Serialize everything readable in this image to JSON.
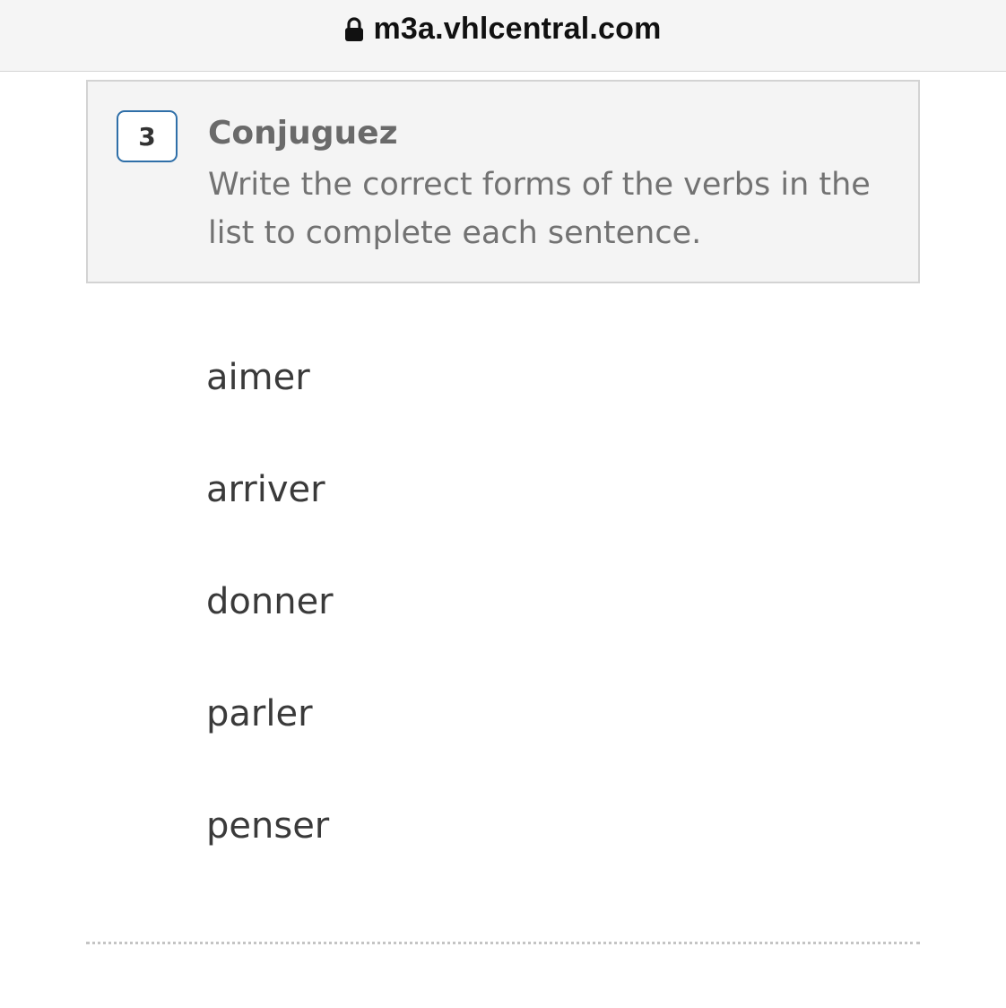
{
  "browser": {
    "url": "m3a.vhlcentral.com",
    "lock_icon": "lock-icon"
  },
  "activity": {
    "number": "3",
    "title": "Conjuguez",
    "instructions": "Write the correct forms of the verbs in the list to complete each sentence.",
    "badge_color": "#2f6fa8"
  },
  "verbs": [
    "aimer",
    "arriver",
    "donner",
    "parler",
    "penser"
  ]
}
